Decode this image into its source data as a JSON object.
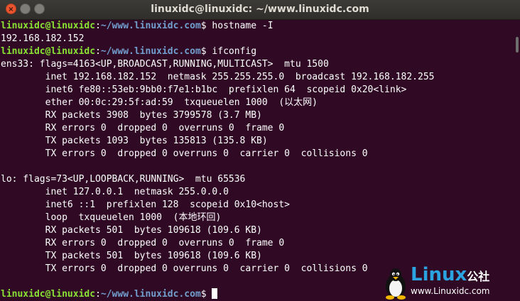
{
  "window": {
    "title": "linuxidc@linuxidc: ~/www.linuxidc.com",
    "buttons": {
      "close": "×",
      "minimize": "",
      "maximize": ""
    }
  },
  "prompt": {
    "userhost": "linuxidc@linuxidc",
    "sep": ":",
    "path": "~/www.linuxidc.com",
    "symbol": "$"
  },
  "lines": [
    {
      "type": "prompt",
      "command": " hostname -I"
    },
    {
      "type": "output",
      "text": "192.168.182.152"
    },
    {
      "type": "prompt",
      "command": " ifconfig"
    },
    {
      "type": "output",
      "text": "ens33: flags=4163<UP,BROADCAST,RUNNING,MULTICAST>  mtu 1500"
    },
    {
      "type": "output",
      "text": "        inet 192.168.182.152  netmask 255.255.255.0  broadcast 192.168.182.255"
    },
    {
      "type": "output",
      "text": "        inet6 fe80::53eb:9bb0:f7e1:b1bc  prefixlen 64  scopeid 0x20<link>"
    },
    {
      "type": "output",
      "text": "        ether 00:0c:29:5f:ad:59  txqueuelen 1000  (以太网)"
    },
    {
      "type": "output",
      "text": "        RX packets 3908  bytes 3799578 (3.7 MB)"
    },
    {
      "type": "output",
      "text": "        RX errors 0  dropped 0  overruns 0  frame 0"
    },
    {
      "type": "output",
      "text": "        TX packets 1093  bytes 135813 (135.8 KB)"
    },
    {
      "type": "output",
      "text": "        TX errors 0  dropped 0 overruns 0  carrier 0  collisions 0"
    },
    {
      "type": "output",
      "text": ""
    },
    {
      "type": "output",
      "text": "lo: flags=73<UP,LOOPBACK,RUNNING>  mtu 65536"
    },
    {
      "type": "output",
      "text": "        inet 127.0.0.1  netmask 255.0.0.0"
    },
    {
      "type": "output",
      "text": "        inet6 ::1  prefixlen 128  scopeid 0x10<host>"
    },
    {
      "type": "output",
      "text": "        loop  txqueuelen 1000  (本地环回)"
    },
    {
      "type": "output",
      "text": "        RX packets 501  bytes 109618 (109.6 KB)"
    },
    {
      "type": "output",
      "text": "        RX errors 0  dropped 0  overruns 0  frame 0"
    },
    {
      "type": "output",
      "text": "        TX packets 501  bytes 109618 (109.6 KB)"
    },
    {
      "type": "output",
      "text": "        TX errors 0  dropped 0 overruns 0  carrier 0  collisions 0"
    },
    {
      "type": "output",
      "text": ""
    },
    {
      "type": "prompt",
      "command": " ",
      "cursor": true
    }
  ],
  "watermark": {
    "brand": "Linux",
    "brand_cn": "公社",
    "url": "www.Linuxidc.com",
    "icon": "tux-penguin-icon"
  },
  "colors": {
    "background": "#300a24",
    "userhost": "#8ae234",
    "path": "#729fcf",
    "text": "#ffffff",
    "watermark": "#2aa3e0"
  }
}
